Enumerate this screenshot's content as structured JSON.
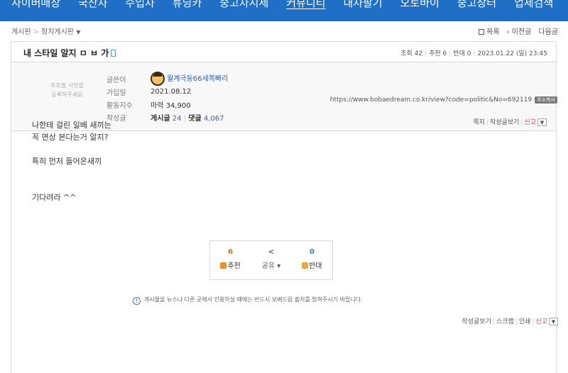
{
  "nav": {
    "items": [
      "사이버매장",
      "국산차",
      "수입차",
      "튜닝카",
      "중고차시세",
      "커뮤니티",
      "내차팔기",
      "오토바이",
      "중고장터",
      "업체검색"
    ],
    "active_index": 5
  },
  "breadcrumb": {
    "root": "게시판",
    "separator": ">",
    "board": "정치게시판"
  },
  "board_nav": {
    "list": "목록",
    "prev": "‹ 이전글",
    "next": "다음글"
  },
  "post": {
    "title": "내 스타일 알지 ㅁ ㅂ 가",
    "views_label": "조회 42",
    "recommend_label": "추천 6",
    "oppose_label": "반대 0",
    "datetime": "2023.01.22 (일) 23:45"
  },
  "author": {
    "photo_placeholder_line1": "프로필 사진을",
    "photo_placeholder_line2": "등록하주세요",
    "name_label": "글쓴이",
    "nickname": "월계극동66세쪽빠리",
    "joined_label": "가입일",
    "joined": "2021.08.12",
    "activity_label": "활동지수",
    "activity": "마력 34,900",
    "posts_label": "작성글",
    "posts_prefix": "게시글",
    "posts_count": "24",
    "comments_prefix": "댓글",
    "comments_count": "4,067",
    "actions": {
      "message": "쪽지",
      "view_posts": "작성글보기",
      "report": "신고"
    }
  },
  "url": {
    "text": "https://www.bobaedream.co.kr/view?code=politic&No=692119",
    "copy_label": "주소복사"
  },
  "content": [
    "나한테 걸린 일베 새끼는",
    "꼭 면상 본다는거 알지?",
    "",
    "특히 먼저 들어온새끼",
    "",
    "",
    "기다려라 ^^"
  ],
  "vote": {
    "up_count": "6",
    "up_label": "추천",
    "share_label": "공유 ▾",
    "down_count": "0",
    "down_label": "반대"
  },
  "notice": "게시물을 뉴스나 다른 곳에서 인용하실 때에는 반드시 보배드림 출처를 밝혀주시기 바랍니다.",
  "footer_links": {
    "view_posts": "작성글보기",
    "scrap": "스크랩",
    "print": "인쇄",
    "report": "신고"
  },
  "colors": {
    "nav_bg": "#1f6fc6",
    "accent_red": "#e04040",
    "link_blue": "#2b5fb3"
  }
}
